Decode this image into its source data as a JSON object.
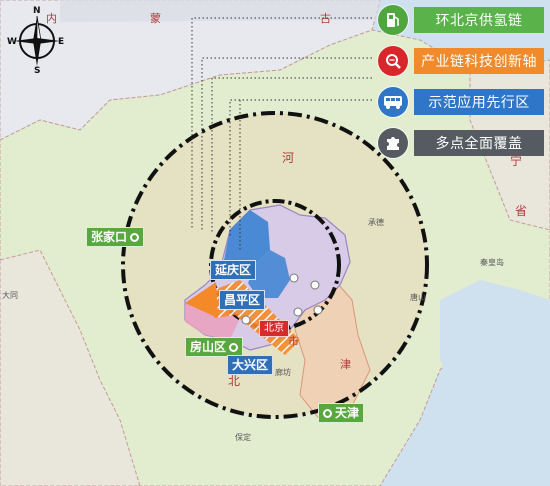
{
  "compass": {
    "n": "N",
    "s": "S",
    "e": "E",
    "w": "W"
  },
  "legend": [
    {
      "label": "环北京供氢链",
      "color": "#5ab34a",
      "icon_color": "#4fa63f",
      "icon": "fuel-station-icon"
    },
    {
      "label": "产业链科技创新轴",
      "color": "#f08a2a",
      "icon_color": "#d8262a",
      "icon": "magnifier-icon"
    },
    {
      "label": "示范应用先行区",
      "color": "#2f75c8",
      "icon_color": "#2f75c8",
      "icon": "bus-icon"
    },
    {
      "label": "多点全面覆盖",
      "color": "#555b61",
      "icon_color": "#555b61",
      "icon": "puzzle-icon"
    }
  ],
  "regions": {
    "zhangjiakou": "张家口",
    "yanqing": "延庆区",
    "changping": "昌平区",
    "fangshan": "房山区",
    "daxing": "大兴区",
    "beijing": "北京",
    "tianjin": "天津"
  },
  "province_labels": {
    "nei": "内",
    "meng": "蒙",
    "gu": "古",
    "he": "河",
    "bei": "北",
    "ning": "宁",
    "sheng": "省",
    "shi": "市",
    "jin": "津"
  },
  "place_labels": {
    "datong": "大同",
    "chengde": "承德",
    "tangshan": "唐山",
    "baoding": "保定",
    "langfang": "廊坊",
    "qinhuangdao": "秦皇岛"
  },
  "colors": {
    "green": "#59a83f",
    "blue": "#2f6fb8",
    "red": "#d62b2b",
    "orange": "#f08a2a",
    "beijing_fill": "#d4c6e6",
    "tianjin_fill": "#f3d7c2",
    "hebei_fill": "#dceec8"
  }
}
